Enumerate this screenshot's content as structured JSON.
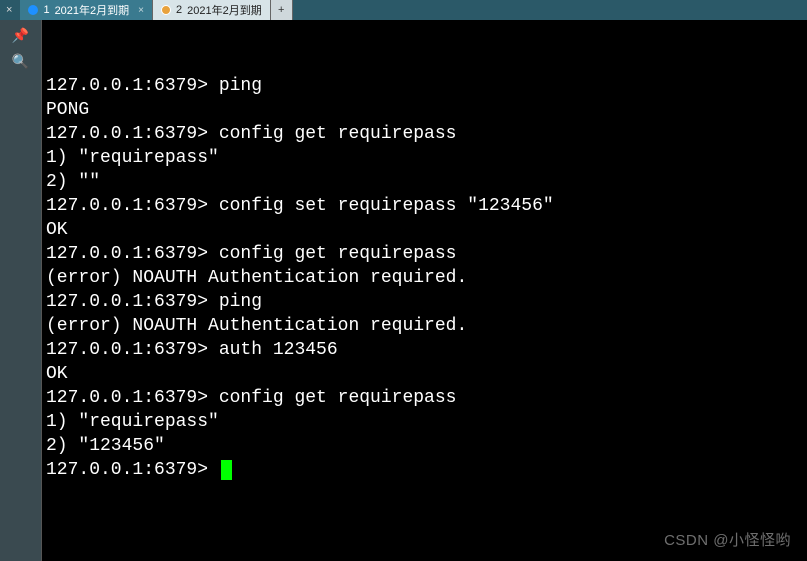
{
  "titlebar": {
    "left_marker": "×"
  },
  "tabs": [
    {
      "index": "1",
      "label": "2021年2月到期",
      "active": true
    },
    {
      "index": "2",
      "label": "2021年2月到期",
      "active": false
    }
  ],
  "new_tab_label": "+",
  "terminal": {
    "prompt": "127.0.0.1:6379>",
    "lines": [
      {
        "type": "cmd",
        "text": "ping"
      },
      {
        "type": "out",
        "text": "PONG"
      },
      {
        "type": "cmd",
        "text": "config get requirepass"
      },
      {
        "type": "out",
        "text": "1) \"requirepass\""
      },
      {
        "type": "out",
        "text": "2) \"\""
      },
      {
        "type": "cmd",
        "text": "config set requirepass \"123456\""
      },
      {
        "type": "out",
        "text": "OK"
      },
      {
        "type": "cmd",
        "text": "config get requirepass"
      },
      {
        "type": "out",
        "text": "(error) NOAUTH Authentication required."
      },
      {
        "type": "cmd",
        "text": "ping"
      },
      {
        "type": "out",
        "text": "(error) NOAUTH Authentication required."
      },
      {
        "type": "cmd",
        "text": "auth 123456"
      },
      {
        "type": "out",
        "text": "OK"
      },
      {
        "type": "cmd",
        "text": "config get requirepass"
      },
      {
        "type": "out",
        "text": "1) \"requirepass\""
      },
      {
        "type": "out",
        "text": "2) \"123456\""
      },
      {
        "type": "cmd",
        "text": "",
        "cursor": true
      }
    ]
  },
  "watermark": "CSDN @小怪怪哟"
}
